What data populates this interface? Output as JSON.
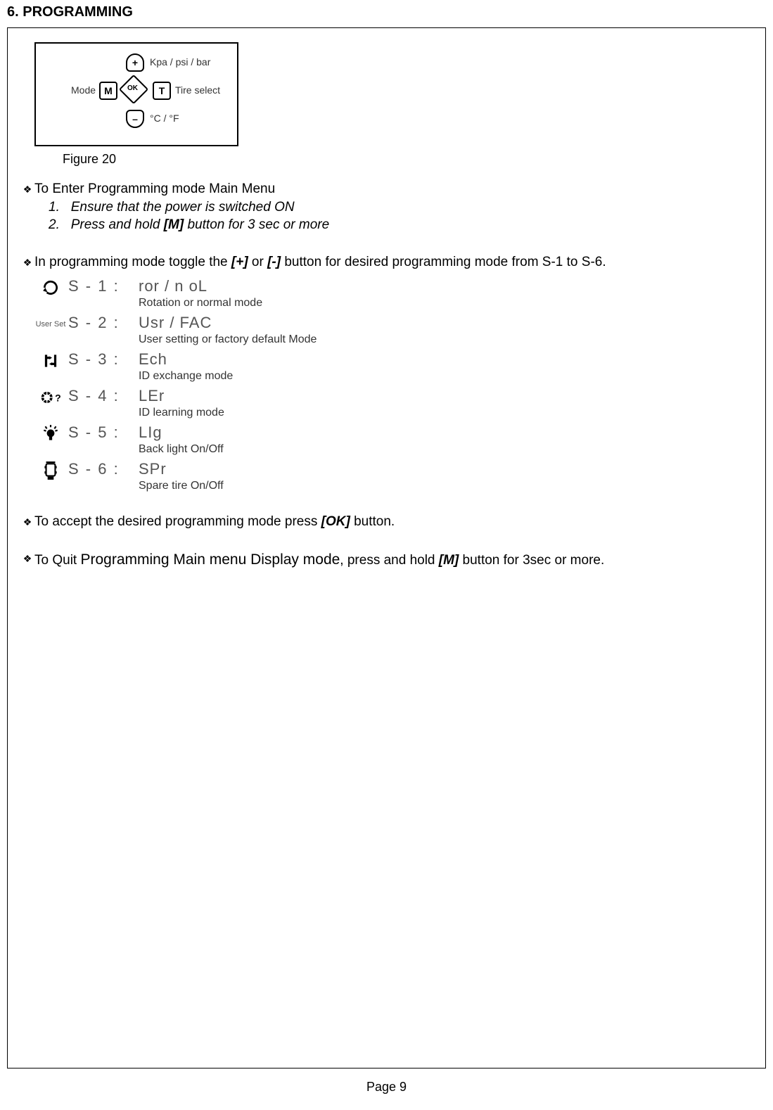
{
  "heading": "6.   PROGRAMMING",
  "figure": {
    "plus": "+",
    "minus": "–",
    "m": "M",
    "ok": "OK",
    "t": "T",
    "label_top": "Kpa / psi / bar",
    "label_left": "Mode",
    "label_right": "Tire select",
    "label_bottom": "°C / °F",
    "caption": "Figure 20"
  },
  "b1": {
    "title": "To Enter Programming mode Main Menu",
    "i1_num": "1.",
    "i1_text": "Ensure that the power is switched ON",
    "i2_num": "2.",
    "i2_text_a": "Press and hold ",
    "i2_btn": "[M]",
    "i2_text_b": " button for 3 sec or more"
  },
  "b2": {
    "pre": "In programming mode toggle the ",
    "btn1": "[+]",
    "mid": " or ",
    "btn2": "[-]",
    "post": " button for desired programming mode from S-1 to S-6."
  },
  "modes": [
    {
      "icon_label": "",
      "code": "S - 1  :",
      "short": "ror / n oL",
      "desc": "Rotation or normal mode",
      "icon": "rotate"
    },
    {
      "icon_label": "User Set",
      "code": "S - 2  :",
      "short": "Usr / FAC",
      "desc": "User setting or factory default Mode",
      "icon": "userset"
    },
    {
      "icon_label": "",
      "code": "S - 3  :",
      "short": "Ech",
      "desc": "ID exchange mode",
      "icon": "swap"
    },
    {
      "icon_label": "",
      "code": "S - 4  :",
      "short": "LEr",
      "desc": "ID learning mode",
      "icon": "wheelq"
    },
    {
      "icon_label": "",
      "code": "S - 5  :",
      "short": "LIg",
      "desc": "Back light On/Off",
      "icon": "bulb"
    },
    {
      "icon_label": "",
      "code": "S - 6  :",
      "short": "SPr",
      "desc": "Spare tire On/Off",
      "icon": "spare"
    }
  ],
  "b3": {
    "pre": "To accept the desired programming mode press ",
    "btn": "[OK]",
    "post": " button."
  },
  "b4": {
    "pre": "To Quit ",
    "large": "Programming Main menu Display mode",
    "mid": ", press and hold ",
    "btn": "[M]",
    "post": " button for 3sec or more."
  },
  "footer": "Page 9"
}
